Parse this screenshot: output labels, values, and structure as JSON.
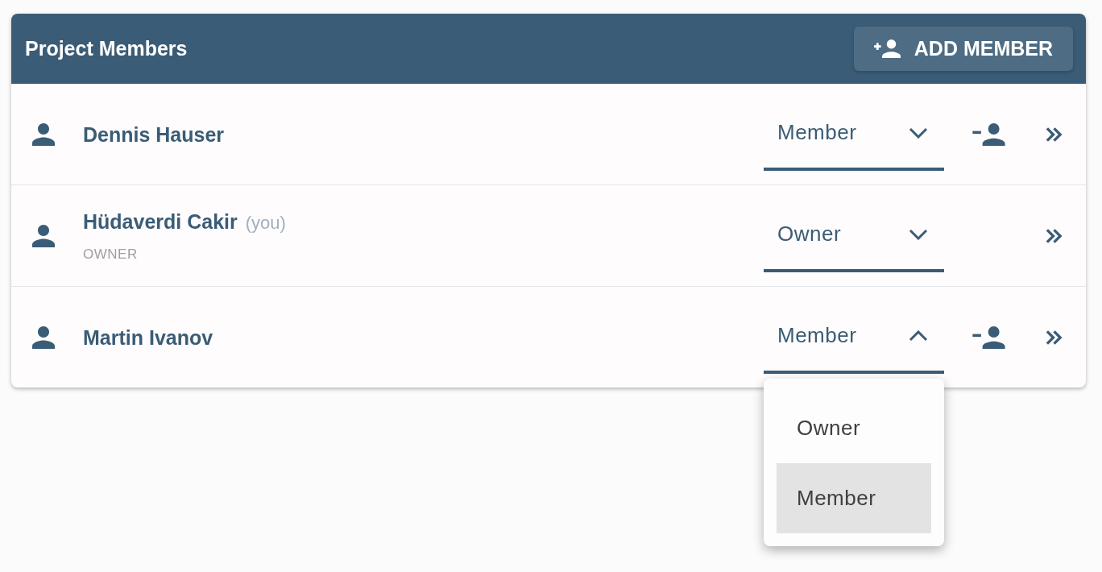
{
  "header": {
    "title": "Project Members",
    "add_button": {
      "label": "ADD MEMBER"
    }
  },
  "members": [
    {
      "name": "Dennis Hauser",
      "role_select": {
        "value": "Member",
        "expanded": false
      },
      "removable": true
    },
    {
      "name": "Hüdaverdi Cakir",
      "you_tag": "(you)",
      "caption": "OWNER",
      "role_select": {
        "value": "Owner",
        "expanded": false
      },
      "removable": false
    },
    {
      "name": "Martin Ivanov",
      "role_select": {
        "value": "Member",
        "expanded": true,
        "options": [
          {
            "label": "Owner",
            "selected": false
          },
          {
            "label": "Member",
            "selected": true
          }
        ]
      },
      "removable": true
    }
  ]
}
